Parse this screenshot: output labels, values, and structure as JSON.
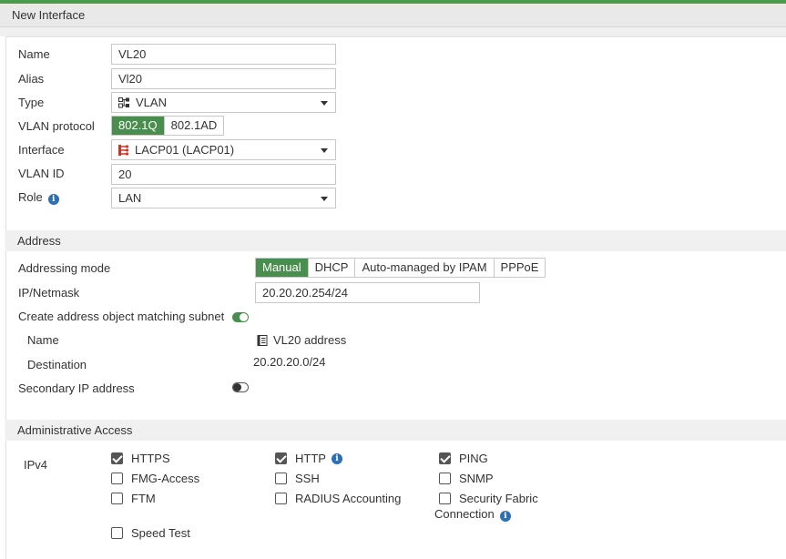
{
  "window": {
    "title": "New Interface"
  },
  "general": {
    "name_label": "Name",
    "name_value": "VL20",
    "alias_label": "Alias",
    "alias_value": "Vl20",
    "type_label": "Type",
    "type_value": "VLAN",
    "type_icon": "vlan-icon",
    "vlan_protocol_label": "VLAN protocol",
    "vlan_protocol_options": [
      "802.1Q",
      "802.1AD"
    ],
    "vlan_protocol_selected": "802.1Q",
    "interface_label": "Interface",
    "interface_value": "LACP01 (LACP01)",
    "interface_icon": "aggregate-icon",
    "vlan_id_label": "VLAN ID",
    "vlan_id_value": "20",
    "role_label": "Role",
    "role_value": "LAN"
  },
  "address": {
    "section_title": "Address",
    "addressing_mode_label": "Addressing mode",
    "modes": [
      "Manual",
      "DHCP",
      "Auto-managed by IPAM",
      "PPPoE"
    ],
    "selected_mode": "Manual",
    "ip_netmask_label": "IP/Netmask",
    "ip_netmask_value": "20.20.20.254/24",
    "create_object_label": "Create address object matching subnet",
    "create_object_enabled": true,
    "object_name_label": "Name",
    "object_name_value": "VL20 address",
    "destination_label": "Destination",
    "destination_value": "20.20.20.0/24",
    "secondary_ip_label": "Secondary IP address",
    "secondary_ip_enabled": false
  },
  "admin_access": {
    "section_title": "Administrative Access",
    "ipv4_label": "IPv4",
    "options": {
      "https": {
        "label": "HTTPS",
        "checked": true
      },
      "http": {
        "label": "HTTP",
        "checked": true
      },
      "ping": {
        "label": "PING",
        "checked": true
      },
      "fmg": {
        "label": "FMG-Access",
        "checked": false
      },
      "ssh": {
        "label": "SSH",
        "checked": false
      },
      "snmp": {
        "label": "SNMP",
        "checked": false
      },
      "ftm": {
        "label": "FTM",
        "checked": false
      },
      "radius": {
        "label": "RADIUS Accounting",
        "checked": false
      },
      "fabric": {
        "label_line1": "Security Fabric",
        "label_line2": "Connection",
        "checked": false
      },
      "speedtest": {
        "label": "Speed Test",
        "checked": false
      }
    }
  },
  "colors": {
    "accent_green": "#4a8e4f",
    "info_blue": "#2c6fb7",
    "aggregate_red": "#c0392b"
  }
}
